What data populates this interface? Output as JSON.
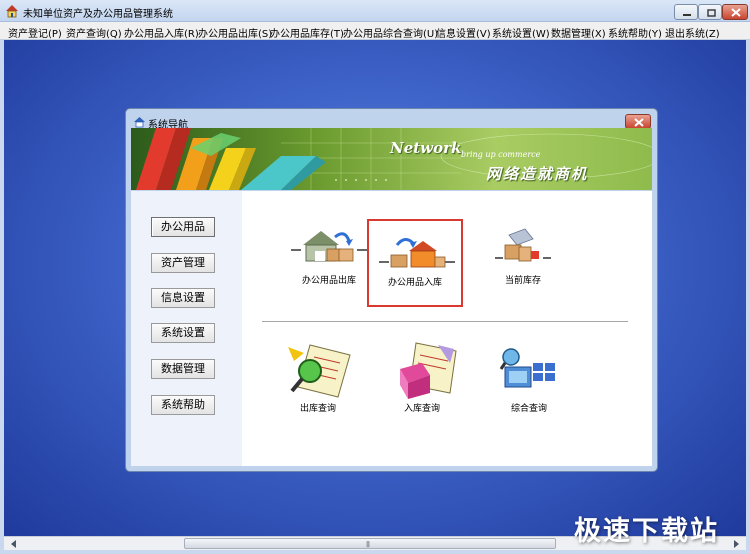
{
  "window": {
    "title": "未知单位资产及办公用品管理系统",
    "icon": "app-house-icon"
  },
  "menu": [
    {
      "label": "资产登记(P)"
    },
    {
      "label": "资产查询(Q)"
    },
    {
      "label": "办公用品入库(R)"
    },
    {
      "label": "办公用品出库(S)"
    },
    {
      "label": "办公用品库存(T)"
    },
    {
      "label": "办公用品综合查询(U)"
    },
    {
      "label": "信息设置(V)"
    },
    {
      "label": "系统设置(W)"
    },
    {
      "label": "数据管理(X)"
    },
    {
      "label": "系统帮助(Y)"
    },
    {
      "label": "退出系统(Z)"
    }
  ],
  "dialog": {
    "title": "系统导航",
    "banner": {
      "english": "Network",
      "english_sub": "bring up commerce",
      "chinese": "网络造就商机"
    },
    "nav": [
      {
        "label": "办公用品",
        "active": true
      },
      {
        "label": "资产管理",
        "active": false
      },
      {
        "label": "信息设置",
        "active": false
      },
      {
        "label": "系统设置",
        "active": false
      },
      {
        "label": "数据管理",
        "active": false
      },
      {
        "label": "系统帮助",
        "active": false
      }
    ],
    "tiles_top": [
      {
        "label": "办公用品出库",
        "icon": "warehouse-out-icon"
      },
      {
        "label": "办公用品入库",
        "icon": "warehouse-in-icon",
        "selected": true
      },
      {
        "label": "当前库存",
        "icon": "stock-icon"
      }
    ],
    "tiles_bottom": [
      {
        "label": "出库查询",
        "icon": "outbound-query-icon"
      },
      {
        "label": "入库查询",
        "icon": "inbound-query-icon"
      },
      {
        "label": "综合查询",
        "icon": "combined-query-icon"
      }
    ]
  },
  "watermark": "极速下载站",
  "colors": {
    "desktop": "#3e63c9",
    "selection": "#d9392e",
    "close_button": "#c8452f"
  }
}
